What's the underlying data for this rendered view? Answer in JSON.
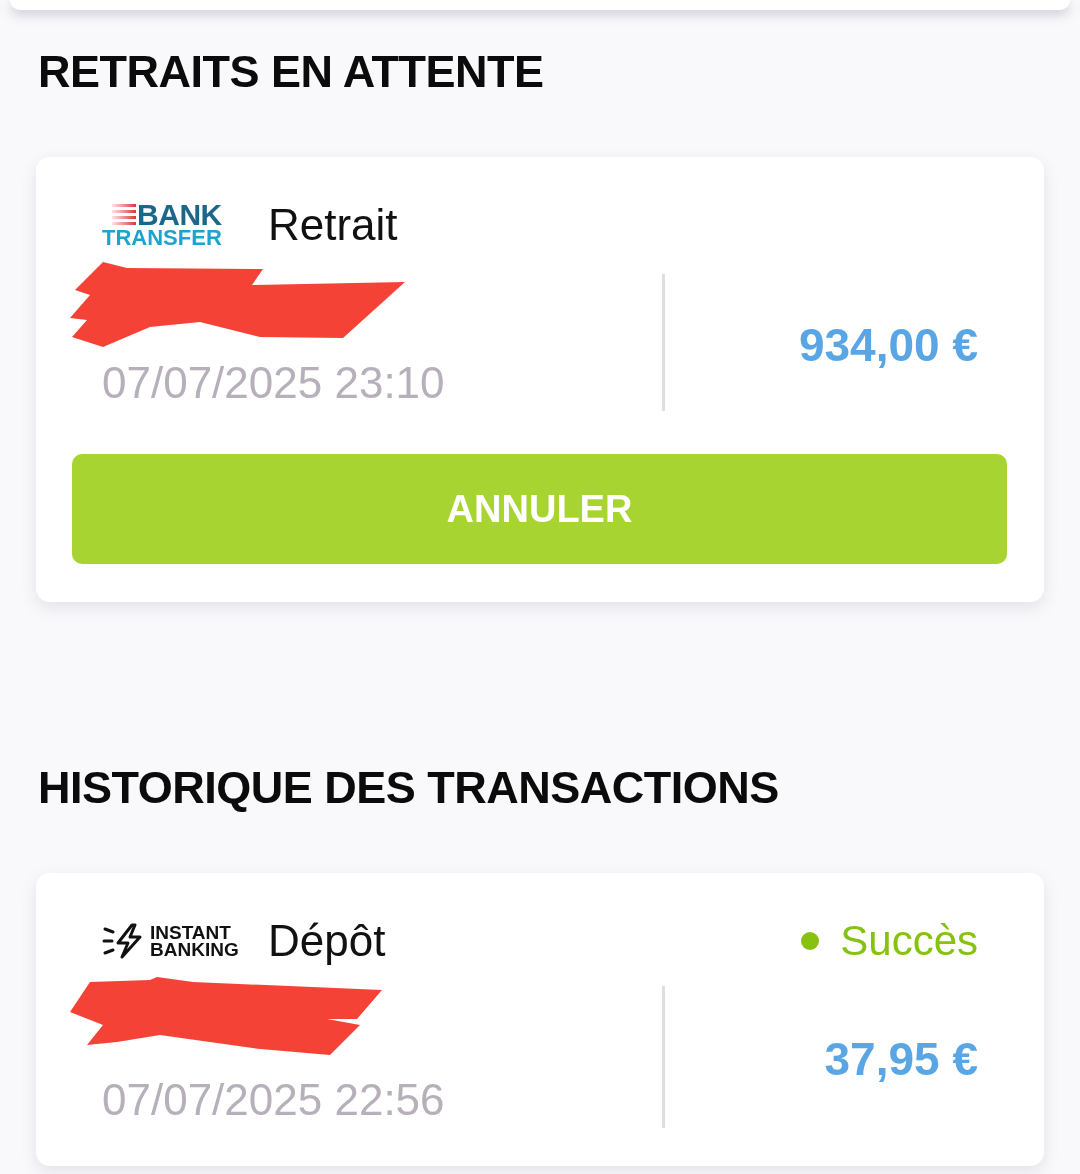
{
  "sections": [
    {
      "title": "RETRAITS EN ATTENTE",
      "transactions": [
        {
          "logo": {
            "kind": "bank_transfer",
            "lines": [
              "BANK",
              "TRANSFER"
            ]
          },
          "type": "Retrait",
          "redacted": true,
          "date": "07/07/2025 23:10",
          "amount": "934,00 €",
          "action": "ANNULER"
        }
      ]
    },
    {
      "title": "HISTORIQUE DES TRANSACTIONS",
      "transactions": [
        {
          "logo": {
            "kind": "instant_banking",
            "lines": [
              "INSTANT",
              "BANKING"
            ]
          },
          "type": "Dépôt",
          "status": {
            "label": "Succès",
            "color": "#87c20f"
          },
          "redacted": true,
          "date": "07/07/2025 22:56",
          "amount": "37,95 €"
        }
      ]
    }
  ]
}
